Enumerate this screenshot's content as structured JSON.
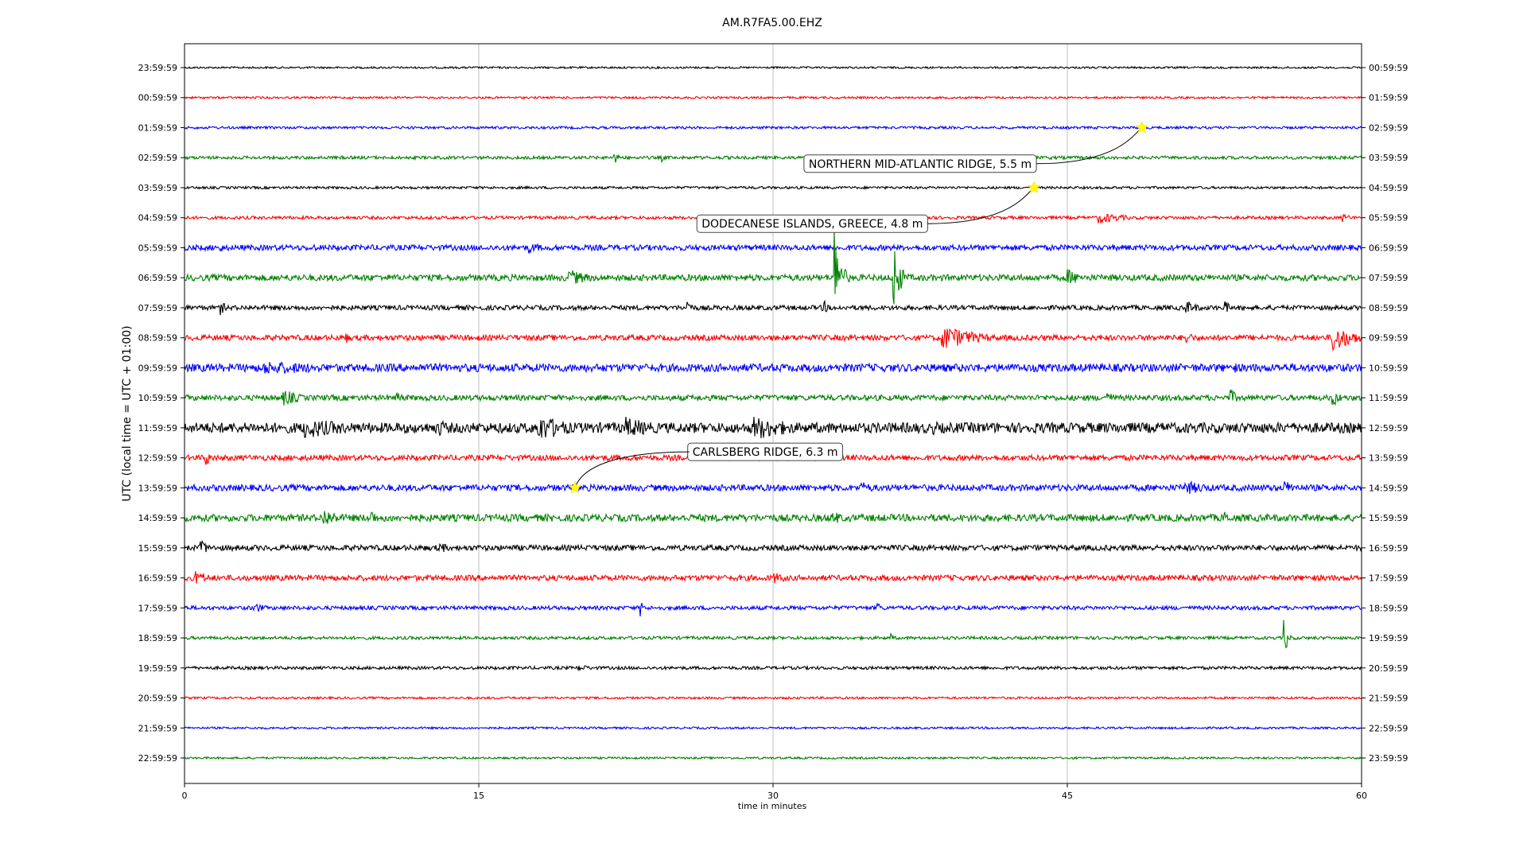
{
  "chart_data": {
    "type": "line",
    "title": "AM.R7FA5.00.EHZ",
    "xlabel": "time in minutes",
    "ylabel": "UTC (local time = UTC + 01:00)",
    "xlim": [
      0,
      60
    ],
    "x_ticks": [
      0,
      15,
      30,
      45,
      60
    ],
    "grid": "vertical lines at 15, 30, 45",
    "legend": "none",
    "colors": [
      "#000000",
      "#ff0000",
      "#0000ff",
      "#008000"
    ],
    "left_labels": [
      "23:59:59",
      "00:59:59",
      "01:59:59",
      "02:59:59",
      "03:59:59",
      "04:59:59",
      "05:59:59",
      "06:59:59",
      "07:59:59",
      "08:59:59",
      "09:59:59",
      "10:59:59",
      "11:59:59",
      "12:59:59",
      "13:59:59",
      "14:59:59",
      "15:59:59",
      "16:59:59",
      "17:59:59",
      "18:59:59",
      "19:59:59",
      "20:59:59",
      "21:59:59",
      "22:59:59"
    ],
    "right_labels": [
      "00:59:59",
      "01:59:59",
      "02:59:59",
      "03:59:59",
      "04:59:59",
      "05:59:59",
      "06:59:59",
      "07:59:59",
      "08:59:59",
      "09:59:59",
      "10:59:59",
      "11:59:59",
      "12:59:59",
      "13:59:59",
      "14:59:59",
      "15:59:59",
      "16:59:59",
      "17:59:59",
      "18:59:59",
      "19:59:59",
      "20:59:59",
      "21:59:59",
      "22:59:59",
      "23:59:59"
    ],
    "noise_levels": [
      1.2,
      1.3,
      1.6,
      2.0,
      1.6,
      2.0,
      3.5,
      4.0,
      3.0,
      3.5,
      5.0,
      3.5,
      6.5,
      3.5,
      4.0,
      4.5,
      3.5,
      3.5,
      2.5,
      2.0,
      2.0,
      1.4,
      1.3,
      1.3
    ],
    "bursts": [
      {
        "row": 3,
        "t": 21.8,
        "amp": 10,
        "dur": 0.6
      },
      {
        "row": 3,
        "t": 24.3,
        "amp": 6,
        "dur": 0.4
      },
      {
        "row": 5,
        "t": 46.5,
        "amp": 8,
        "dur": 2.5
      },
      {
        "row": 5,
        "t": 59.0,
        "amp": 6,
        "dur": 0.8
      },
      {
        "row": 6,
        "t": 1.8,
        "amp": 7,
        "dur": 0.5
      },
      {
        "row": 6,
        "t": 6.5,
        "amp": 8,
        "dur": 0.4
      },
      {
        "row": 6,
        "t": 17.5,
        "amp": 8,
        "dur": 1.5
      },
      {
        "row": 7,
        "t": 19.5,
        "amp": 12,
        "dur": 2.0
      },
      {
        "row": 7,
        "t": 33.1,
        "amp": 75,
        "dur": 0.5
      },
      {
        "row": 7,
        "t": 36.1,
        "amp": 62,
        "dur": 0.5
      },
      {
        "row": 7,
        "t": 45.0,
        "amp": 12,
        "dur": 1.2
      },
      {
        "row": 8,
        "t": 1.8,
        "amp": 10,
        "dur": 0.6
      },
      {
        "row": 8,
        "t": 25.6,
        "amp": 12,
        "dur": 0.5
      },
      {
        "row": 8,
        "t": 32.5,
        "amp": 18,
        "dur": 0.3
      },
      {
        "row": 8,
        "t": 51.0,
        "amp": 10,
        "dur": 1.2
      },
      {
        "row": 8,
        "t": 53.0,
        "amp": 12,
        "dur": 0.4
      },
      {
        "row": 9,
        "t": 8.2,
        "amp": 8,
        "dur": 0.6
      },
      {
        "row": 9,
        "t": 38.5,
        "amp": 18,
        "dur": 3.0
      },
      {
        "row": 9,
        "t": 51.0,
        "amp": 10,
        "dur": 0.8
      },
      {
        "row": 9,
        "t": 58.5,
        "amp": 20,
        "dur": 1.8
      },
      {
        "row": 10,
        "t": 4.0,
        "amp": 9,
        "dur": 9.0
      },
      {
        "row": 10,
        "t": 41.7,
        "amp": 12,
        "dur": 0.5
      },
      {
        "row": 10,
        "t": 53.5,
        "amp": 8,
        "dur": 0.5
      },
      {
        "row": 11,
        "t": 5.0,
        "amp": 12,
        "dur": 1.5
      },
      {
        "row": 11,
        "t": 10.8,
        "amp": 12,
        "dur": 0.5
      },
      {
        "row": 11,
        "t": 47.0,
        "amp": 12,
        "dur": 0.5
      },
      {
        "row": 11,
        "t": 53.3,
        "amp": 14,
        "dur": 0.5
      },
      {
        "row": 11,
        "t": 58.5,
        "amp": 12,
        "dur": 0.8
      },
      {
        "row": 12,
        "t": 6.0,
        "amp": 14,
        "dur": 5.0
      },
      {
        "row": 12,
        "t": 13.0,
        "amp": 16,
        "dur": 0.5
      },
      {
        "row": 12,
        "t": 18.0,
        "amp": 18,
        "dur": 3.0
      },
      {
        "row": 12,
        "t": 22.5,
        "amp": 14,
        "dur": 3.0
      },
      {
        "row": 12,
        "t": 29.0,
        "amp": 16,
        "dur": 4.0
      },
      {
        "row": 12,
        "t": 38.0,
        "amp": 10,
        "dur": 2.0
      },
      {
        "row": 13,
        "t": 1.0,
        "amp": 14,
        "dur": 0.6
      },
      {
        "row": 14,
        "t": 34.5,
        "amp": 8,
        "dur": 1.5
      },
      {
        "row": 14,
        "t": 51.0,
        "amp": 9,
        "dur": 3.0
      },
      {
        "row": 14,
        "t": 56.0,
        "amp": 10,
        "dur": 1.5
      },
      {
        "row": 15,
        "t": 7.0,
        "amp": 14,
        "dur": 1.5
      },
      {
        "row": 15,
        "t": 9.5,
        "amp": 22,
        "dur": 0.3
      },
      {
        "row": 15,
        "t": 33.0,
        "amp": 10,
        "dur": 1.2
      },
      {
        "row": 15,
        "t": 53.0,
        "amp": 12,
        "dur": 0.5
      },
      {
        "row": 16,
        "t": 0.8,
        "amp": 14,
        "dur": 0.6
      },
      {
        "row": 16,
        "t": 13.0,
        "amp": 12,
        "dur": 0.5
      },
      {
        "row": 17,
        "t": 0.5,
        "amp": 10,
        "dur": 1.5
      },
      {
        "row": 17,
        "t": 30.0,
        "amp": 8,
        "dur": 1.5
      },
      {
        "row": 18,
        "t": 3.5,
        "amp": 8,
        "dur": 1.0
      },
      {
        "row": 18,
        "t": 23.2,
        "amp": 14,
        "dur": 0.3
      },
      {
        "row": 18,
        "t": 35.3,
        "amp": 10,
        "dur": 0.3
      },
      {
        "row": 19,
        "t": 56.0,
        "amp": 34,
        "dur": 0.3
      },
      {
        "row": 19,
        "t": 36.0,
        "amp": 6,
        "dur": 0.3
      },
      {
        "row": 20,
        "t": 20.0,
        "amp": 5,
        "dur": 1.5
      }
    ],
    "annotations": [
      {
        "label": "NORTHERN MID-ATLANTIC RIDGE, 5.5 m",
        "row": 2,
        "t": 48.8,
        "label_row": 3.2,
        "label_t": 37.5
      },
      {
        "label": "DODECANESE ISLANDS, GREECE, 4.8 m",
        "row": 4,
        "t": 43.3,
        "label_row": 5.2,
        "label_t": 32.0
      },
      {
        "label": "CARLSBERG RIDGE, 6.3 m",
        "row": 14,
        "t": 19.9,
        "label_row": 12.8,
        "label_t": 29.6
      }
    ]
  }
}
